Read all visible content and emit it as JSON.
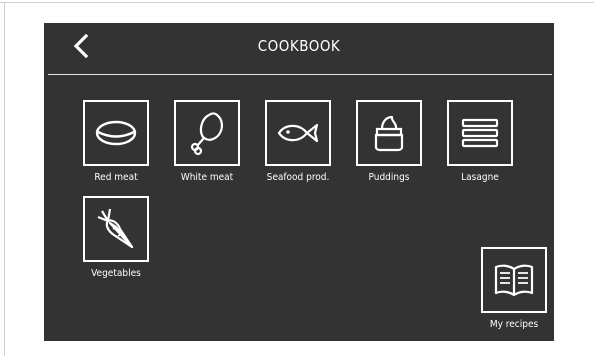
{
  "header": {
    "title": "COOKBOOK",
    "back_icon": "chevron-left-icon"
  },
  "categories": [
    {
      "label": "Red meat",
      "icon": "steak-icon"
    },
    {
      "label": "White meat",
      "icon": "chicken-leg-icon"
    },
    {
      "label": "Seafood prod.",
      "icon": "fish-icon"
    },
    {
      "label": "Puddings",
      "icon": "pudding-icon"
    },
    {
      "label": "Lasagne",
      "icon": "lasagne-icon"
    },
    {
      "label": "Vegetables",
      "icon": "carrot-icon"
    }
  ],
  "my_recipes": {
    "label": "My recipes",
    "icon": "open-book-icon"
  },
  "colors": {
    "screen_bg": "#333333",
    "foreground": "#ffffff",
    "page_bg": "#ffffff"
  }
}
